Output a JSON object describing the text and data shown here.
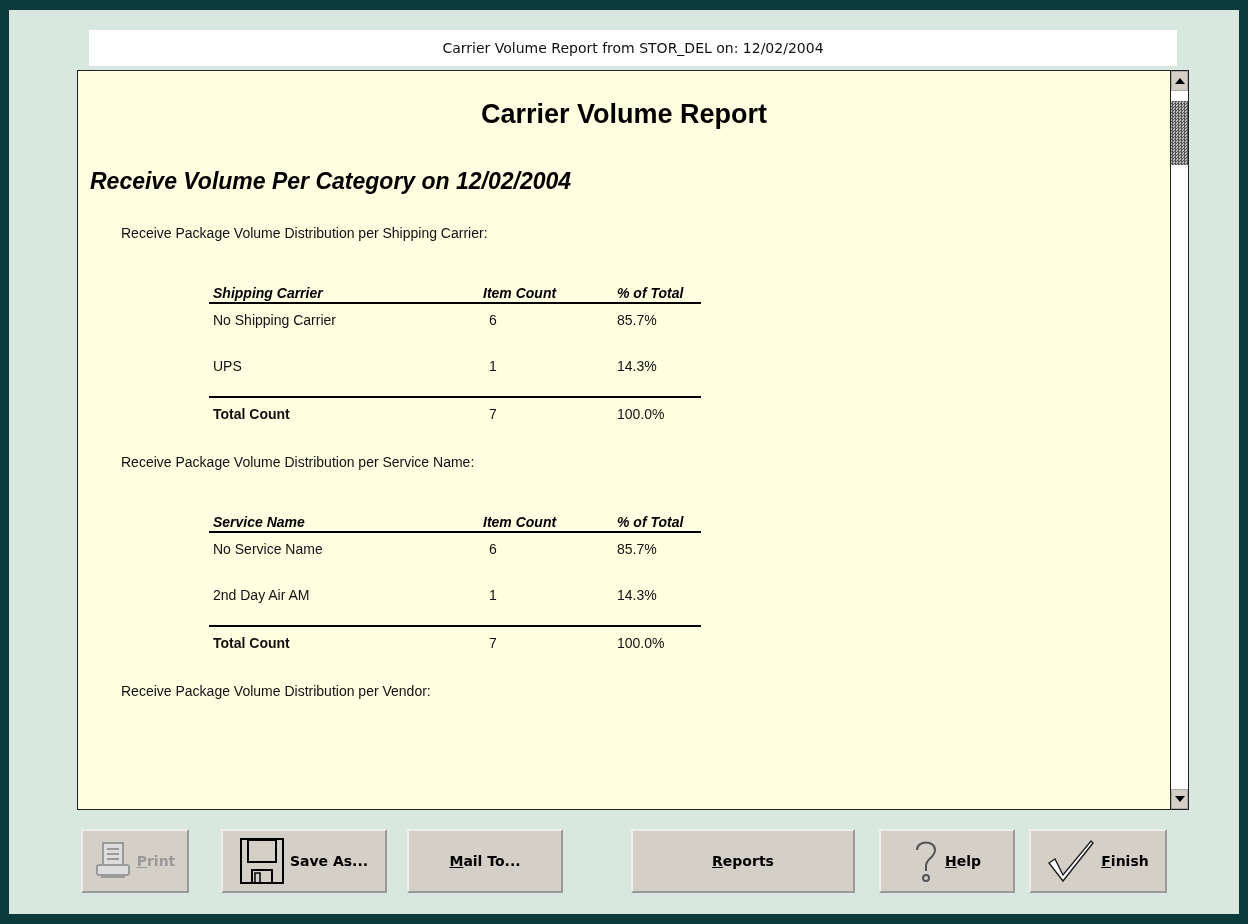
{
  "window": {
    "title": "Carrier Volume Report from STOR_DEL on: 12/02/2004"
  },
  "report": {
    "title": "Carrier Volume Report",
    "subtitle": "Receive Volume Per Category on 12/02/2004",
    "sections": [
      {
        "caption": "Receive Package Volume Distribution per Shipping Carrier:",
        "columns": [
          "Shipping Carrier",
          "Item Count",
          "% of Total"
        ],
        "rows": [
          [
            "No Shipping Carrier",
            "6",
            "85.7%"
          ],
          [
            "UPS",
            "1",
            "14.3%"
          ]
        ],
        "total": [
          "Total Count",
          "7",
          "100.0%"
        ]
      },
      {
        "caption": "Receive Package Volume Distribution per Service Name:",
        "columns": [
          "Service Name",
          "Item Count",
          "% of Total"
        ],
        "rows": [
          [
            "No Service Name",
            "6",
            "85.7%"
          ],
          [
            "2nd Day Air AM",
            "1",
            "14.3%"
          ]
        ],
        "total": [
          "Total Count",
          "7",
          "100.0%"
        ]
      },
      {
        "caption": "Receive Package Volume Distribution per Vendor:"
      }
    ]
  },
  "buttons": [
    {
      "label": "Print",
      "kind": "print",
      "mnemonic": true,
      "disabled": true
    },
    {
      "label": "Save As...",
      "kind": "save",
      "mnemonic": false,
      "disabled": false
    },
    {
      "label": "Mail To...",
      "kind": "plain",
      "mnemonic": true,
      "disabled": false
    },
    {
      "label": "Reports",
      "kind": "wide",
      "mnemonic": true,
      "disabled": false
    },
    {
      "label": "Help",
      "kind": "help",
      "mnemonic": true,
      "disabled": false
    },
    {
      "label": "Finish",
      "kind": "finish",
      "mnemonic": true,
      "disabled": false
    }
  ]
}
